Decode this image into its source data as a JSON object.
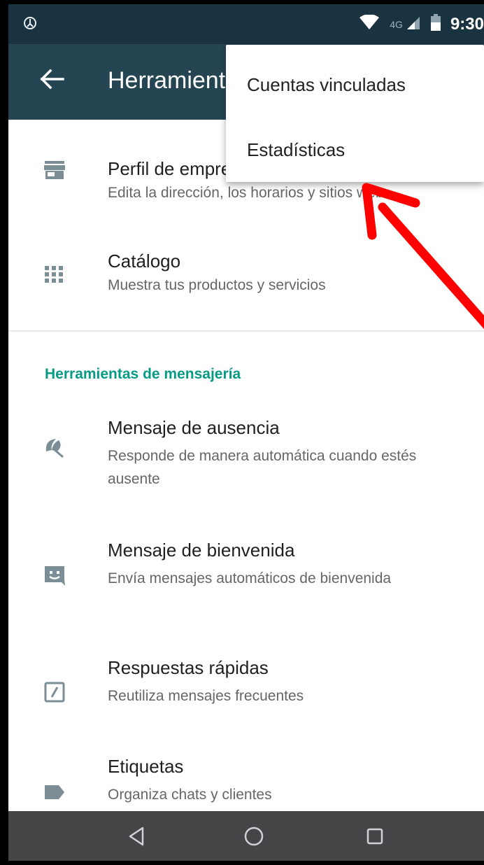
{
  "status_bar": {
    "left_icon": "data-saver-icon",
    "network": "4G",
    "time": "9:30",
    "icons": [
      "wifi-icon",
      "signal-icon",
      "battery-icon"
    ]
  },
  "app_bar": {
    "title": "Herramientas para la empresa",
    "back_icon": "back-arrow-icon"
  },
  "overflow_menu": {
    "items": [
      "Cuentas vinculadas",
      "Estadísticas"
    ]
  },
  "items": [
    {
      "title": "Perfil de empresa",
      "subtitle": "Edita la dirección, los horarios y sitios web",
      "icon": "store-icon"
    },
    {
      "title": "Catálogo",
      "subtitle": "Muestra tus productos y servicios",
      "icon": "grid-icon"
    }
  ],
  "section": {
    "title": "Herramientas de mensajería",
    "items": [
      {
        "title": "Mensaje de ausencia",
        "subtitle": "Responde de manera automática cuando estés ausente",
        "icon": "beach-umbrella-icon"
      },
      {
        "title": "Mensaje de bienvenida",
        "subtitle": "Envía mensajes automáticos de bienvenida",
        "icon": "smiley-message-icon"
      },
      {
        "title": "Respuestas rápidas",
        "subtitle": "Reutiliza mensajes frecuentes",
        "icon": "quick-reply-icon"
      },
      {
        "title": "Etiquetas",
        "subtitle": "Organiza chats y clientes",
        "icon": "label-icon"
      }
    ]
  },
  "nav_bar": {
    "buttons": [
      "back-triangle-icon",
      "home-circle-icon",
      "recents-square-icon"
    ]
  },
  "annotation": {
    "color": "#ff0000",
    "points_to": "Estadísticas"
  },
  "colors": {
    "status_bar": "#1a3341",
    "app_bar": "#254553",
    "accent": "#079b86",
    "icon_gray": "#7b8d95",
    "nav_bar": "#434547"
  }
}
